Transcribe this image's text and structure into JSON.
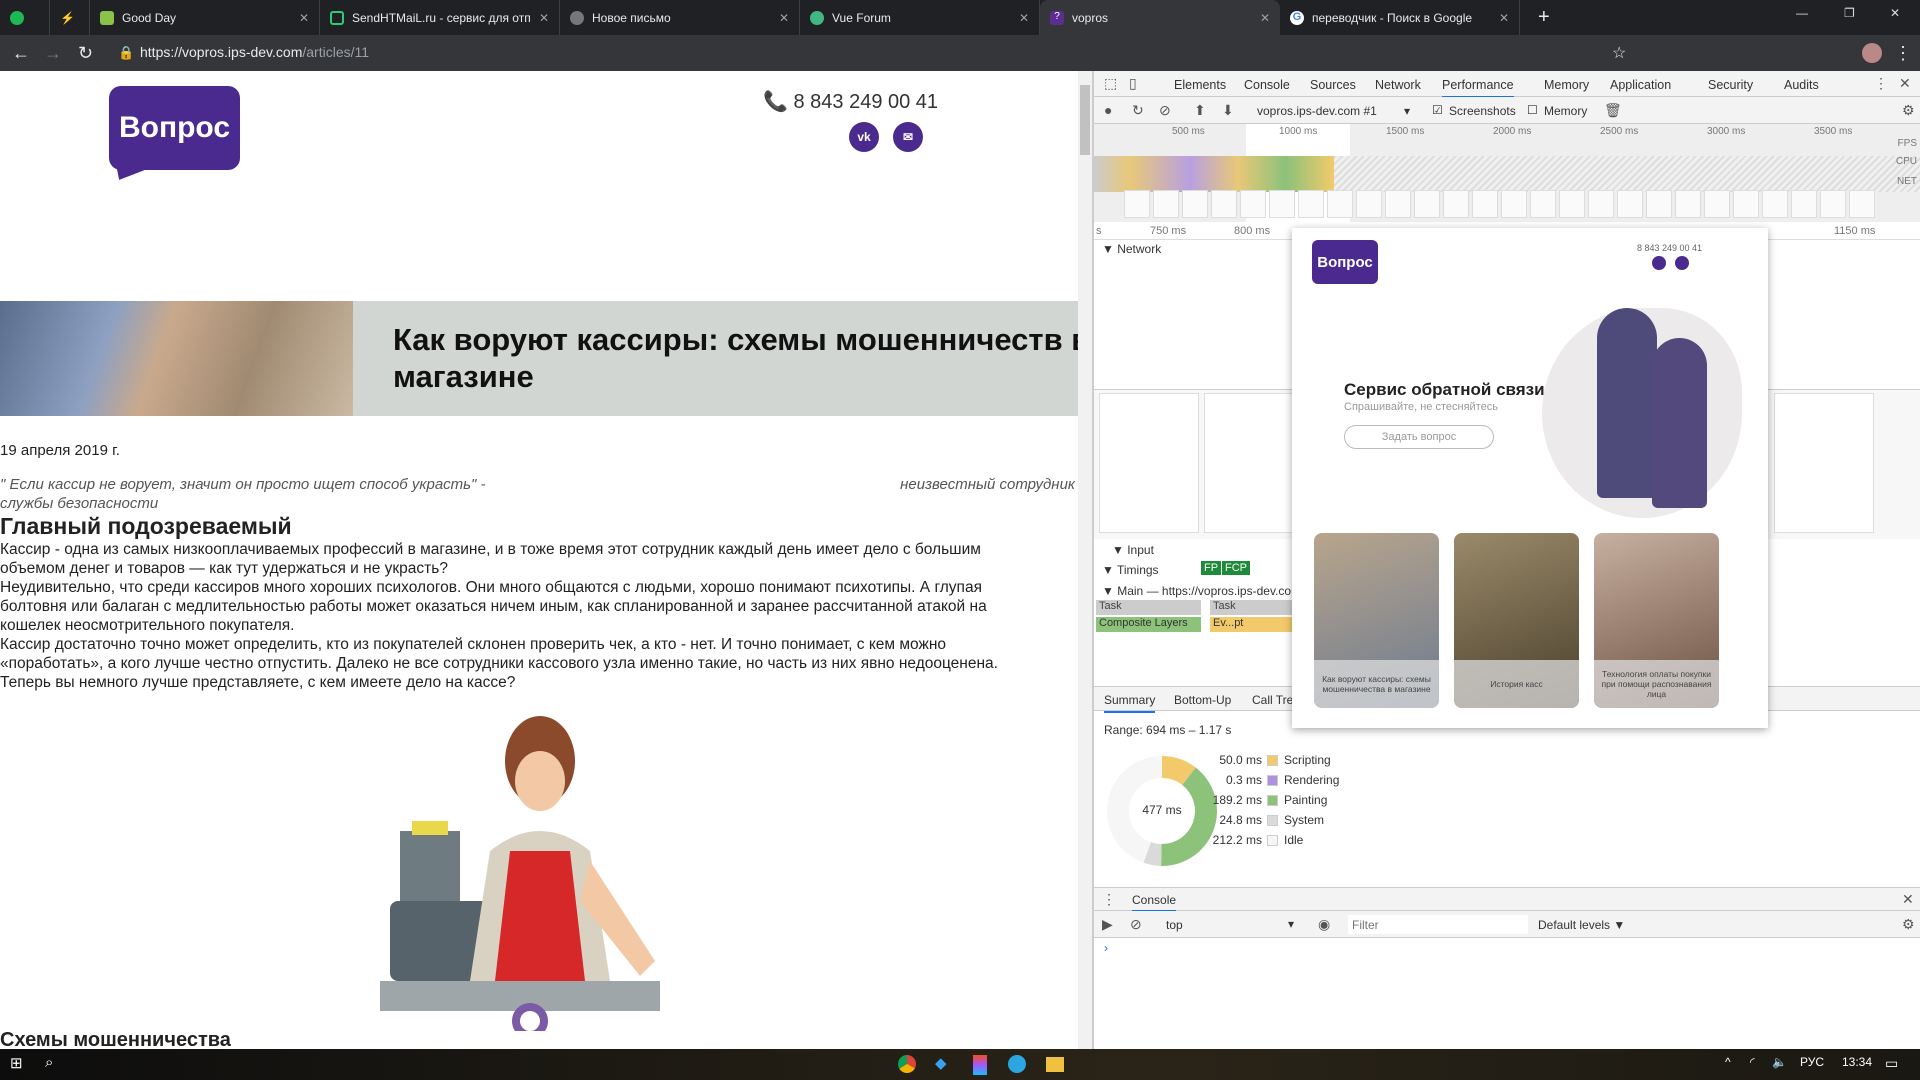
{
  "browser": {
    "tabs": [
      {
        "title": "",
        "icon": "spotify-icon",
        "color": "#1db954"
      },
      {
        "title": "",
        "icon": "bolt-icon",
        "color": "#2ecc71"
      },
      {
        "title": "Good Day",
        "icon": "goodday-icon",
        "color": "#8bc34a"
      },
      {
        "title": "SendHTMaiL.ru - сервис для отп",
        "icon": "mail-check-icon",
        "color": "#2ecc71"
      },
      {
        "title": "Новое письмо",
        "icon": "globe-icon",
        "color": "#777777"
      },
      {
        "title": "Vue Forum",
        "icon": "vue-icon",
        "color": "#41b883"
      },
      {
        "title": "vopros",
        "icon": "question-icon",
        "color": "#5b2d90",
        "active": true
      },
      {
        "title": "переводчик - Поиск в Google",
        "icon": "google-icon",
        "color": "#4285f4"
      }
    ],
    "url_host": "https://vopros.ips-dev.com",
    "url_path": "/articles/11"
  },
  "site": {
    "logo": "Вопрос",
    "phone": "8 843 249 00 41",
    "brand_color": "#4a2a8f",
    "social": [
      "vk",
      "mail"
    ],
    "title_line1": "Как воруют кассиры: схемы мошенничеств в",
    "title_line2": "магазине",
    "date": "19 апреля 2019 г.",
    "quote": "\" Если кассир не ворует, значит он просто ищет способ украсть\" -",
    "quote_author": "неизвестный сотрудник",
    "quote_line2": "службы безопасности",
    "h2": "Главный подозреваемый",
    "paragraphs": [
      "Кассир - одна из самых низкооплачиваемых профессий в магазине, и в тоже время этот сотрудник каждый день имеет дело с большим",
      "объемом денег и товаров — как тут удержаться и не украсть?",
      "Неудивительно, что среди кассиров много хороших психологов. Они много общаются с людьми, хорошо понимают психотипы. А глупая",
      "болтовня или балаган с медлительностью работы может оказаться ничем иным, как спланированной и заранее рассчитанной атакой на",
      "кошелек неосмотрительного покупателя.",
      "Кассир достаточно точно может определить, кто из покупателей склонен проверить чек, а кто - нет. И точно понимает, с кем можно",
      "«поработать», а кого лучше честно отпустить. Далеко не все сотрудники кассового узла именно такие, но часть из них явно недооценена.",
      "Теперь вы немного лучше представляете, с кем имеете дело на кассе?"
    ],
    "h3": "Схемы мошенничества"
  },
  "devtools": {
    "tabs": [
      "Elements",
      "Console",
      "Sources",
      "Network",
      "Performance",
      "Memory",
      "Application",
      "Security",
      "Audits"
    ],
    "active_tab": "Performance",
    "target": "vopros.ips-dev.com #1",
    "screenshots_label": "Screenshots",
    "screenshots_checked": true,
    "memory_label": "Memory",
    "memory_checked": false,
    "overview_ticks": [
      "500 ms",
      "1000 ms",
      "1500 ms",
      "2000 ms",
      "2500 ms",
      "3000 ms",
      "3500 ms"
    ],
    "overview_rows": [
      "FPS",
      "CPU",
      "NET"
    ],
    "detail_ticks": [
      "s",
      "750 ms",
      "800 ms",
      "1150 ms"
    ],
    "tracks": {
      "network": "Network",
      "input": "Input",
      "timings": "Timings",
      "fp": "FP",
      "fcp": "FCP",
      "main": "Main — https://vopros.ips-dev.com/a",
      "task1": "Task",
      "task2": "Task",
      "composite": "Composite Layers",
      "event": "Ev...pt"
    },
    "bottom_tabs": [
      "Summary",
      "Bottom-Up",
      "Call Tre"
    ],
    "range": "Range: 694 ms – 1.17 s",
    "total": "477 ms",
    "summary": [
      {
        "value": "50.0 ms",
        "ms": 50.0,
        "label": "Scripting",
        "color": "#f2ca6b"
      },
      {
        "value": "0.3 ms",
        "ms": 0.3,
        "label": "Rendering",
        "color": "#af91e3"
      },
      {
        "value": "189.2 ms",
        "ms": 189.2,
        "label": "Painting",
        "color": "#8cc27a"
      },
      {
        "value": "24.8 ms",
        "ms": 24.8,
        "label": "System",
        "color": "#dadada"
      },
      {
        "value": "212.2 ms",
        "ms": 212.2,
        "label": "Idle",
        "color": "#f6f6f6"
      }
    ],
    "console": {
      "tab": "Console",
      "context": "top",
      "filter_placeholder": "Filter",
      "levels": "Default levels ▼",
      "prompt": "›"
    }
  },
  "popup": {
    "phone": "8 843 249 00 41",
    "title": "Сервис обратной связи",
    "subtitle": "Спрашивайте, не стесняйтесь",
    "button": "Задать вопрос",
    "cards": [
      "Как воруют кассиры: схемы мошенничества в магазине",
      "История касс",
      "Технология оплаты покупки при помощи распознавания лица"
    ]
  },
  "taskbar": {
    "lang": "РУС",
    "time": "13:34"
  }
}
